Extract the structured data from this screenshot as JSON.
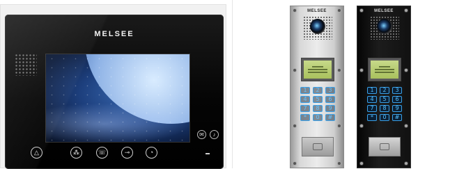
{
  "monitor": {
    "brand": "MELSEE",
    "side_icons": [
      "mail-icon",
      "doorbell-icon"
    ],
    "buttons": [
      "alarm-bell-icon",
      "intercom-icon",
      "phone-icon",
      "unlock-key-icon",
      "monitor-eye-icon"
    ]
  },
  "door_panels": {
    "silver": {
      "brand": "MELSEE",
      "keys": [
        "1",
        "2",
        "3",
        "4",
        "5",
        "6",
        "7",
        "8",
        "9",
        "*",
        "0",
        "#"
      ]
    },
    "black": {
      "brand": "MELSEE",
      "keys": [
        "1",
        "2",
        "3",
        "4",
        "5",
        "6",
        "7",
        "8",
        "9",
        "*",
        "0",
        "#"
      ]
    }
  },
  "colors": {
    "keypad_backlight": "#3aa0e8",
    "monitor_body": "#050505",
    "silver_panel": "#e0e0e0",
    "black_panel": "#111111"
  }
}
